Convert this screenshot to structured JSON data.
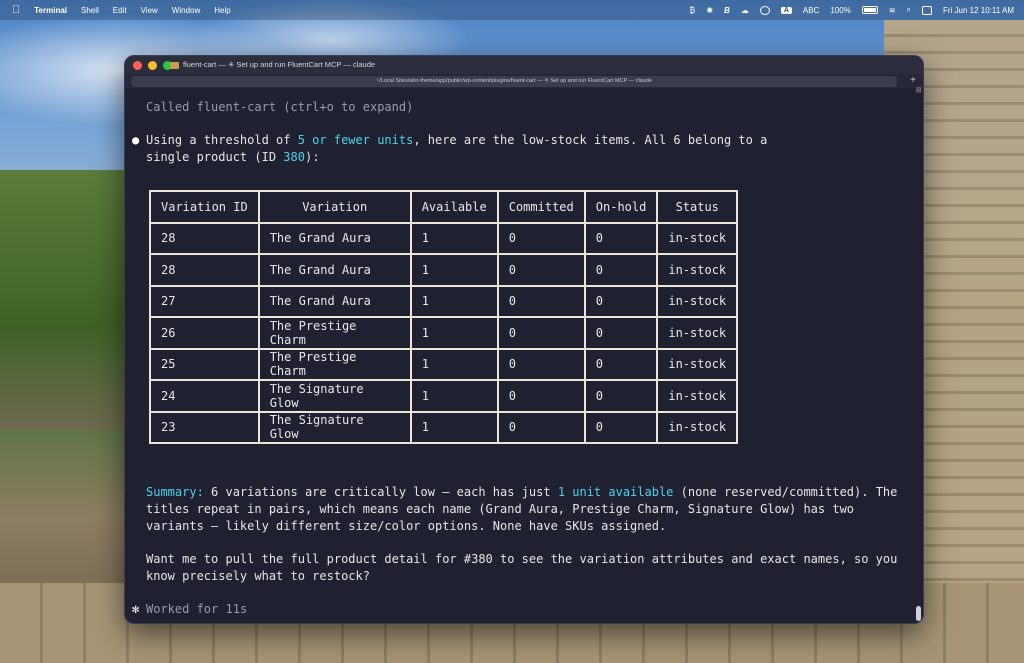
{
  "menubar": {
    "app_name": "Terminal",
    "menus": [
      "Shell",
      "Edit",
      "View",
      "Window",
      "Help"
    ],
    "input_source": "ABC",
    "battery": "100%",
    "datetime": "Fri Jun 12  10:11 AM"
  },
  "window": {
    "title": "fluent-cart — ✳ Set up and run FluentCart MCP — claude",
    "tab_title": "~/Local Sites/abir-theme/app/public/wp-content/plugins/fluent-cart — ✳ Set up and run FluentCart MCP — claude"
  },
  "terminal": {
    "called_line": "Called fluent-cart (ctrl+o to expand)",
    "intro_prefix": "Using a threshold of ",
    "intro_highlight": "5 or fewer units",
    "intro_suffix": ", here are the low-stock items. All 6 belong to a",
    "intro_line2_prefix": "single product (ID ",
    "intro_line2_id": "380",
    "intro_line2_suffix": "):",
    "table": {
      "headers": [
        "Variation ID",
        "Variation",
        "Available",
        "Committed",
        "On-hold",
        "Status"
      ],
      "rows": [
        [
          "28",
          "The Grand Aura",
          "1",
          "0",
          "0",
          "in-stock"
        ],
        [
          "28",
          "The Grand Aura",
          "1",
          "0",
          "0",
          "in-stock"
        ],
        [
          "27",
          "The Grand Aura",
          "1",
          "0",
          "0",
          "in-stock"
        ],
        [
          "26",
          "The Prestige Charm",
          "1",
          "0",
          "0",
          "in-stock"
        ],
        [
          "25",
          "The Prestige Charm",
          "1",
          "0",
          "0",
          "in-stock"
        ],
        [
          "24",
          "The Signature Glow",
          "1",
          "0",
          "0",
          "in-stock"
        ],
        [
          "23",
          "The Signature Glow",
          "1",
          "0",
          "0",
          "in-stock"
        ]
      ]
    },
    "summary_label": "Summary:",
    "summary_a": " 6 variations are critically low — each has just ",
    "summary_highlight": "1 unit available",
    "summary_b": " (none reserved/committed). The",
    "summary_line2": "titles repeat in pairs, which means each name (Grand Aura, Prestige Charm, Signature Glow) has two",
    "summary_line3": "variants — likely different size/color options. None have SKUs assigned.",
    "question_line1": "Want me to pull the full product detail for #380 to see the variation attributes and exact names, so you",
    "question_line2": "know precisely what to restock?",
    "worked_line": "Worked for 11s"
  }
}
